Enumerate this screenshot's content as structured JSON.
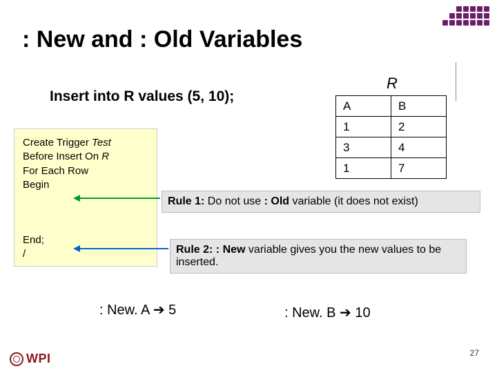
{
  "title": ": New and : Old Variables",
  "insert_statement": "Insert into R values (5, 10);",
  "table": {
    "name": "R",
    "headers": [
      "A",
      "B"
    ],
    "rows": [
      [
        "1",
        "2"
      ],
      [
        "3",
        "4"
      ],
      [
        "1",
        "7"
      ]
    ]
  },
  "code": {
    "l1a": "Create Trigger ",
    "l1b": "Test",
    "l2a": "Before Insert On ",
    "l2b": "R",
    "l3": "For Each Row",
    "l4": "Begin",
    "l5": "End;",
    "l6": "/"
  },
  "rules": {
    "r1_label": "Rule 1:",
    "r1_text_a": " Do not use ",
    "r1_bold": ": Old",
    "r1_text_b": " variable (it does not exist)",
    "r2_label": "Rule 2:",
    "r2_bold": " : New",
    "r2_text": " variable gives you the new values to be inserted."
  },
  "new_vals": {
    "a_label": ": New. A ",
    "a_arrow": "➔",
    "a_val": " 5",
    "b_label": ": New. B ",
    "b_arrow": "➔",
    "b_val": " 10"
  },
  "page_number": "27",
  "logo_text": "WPI"
}
